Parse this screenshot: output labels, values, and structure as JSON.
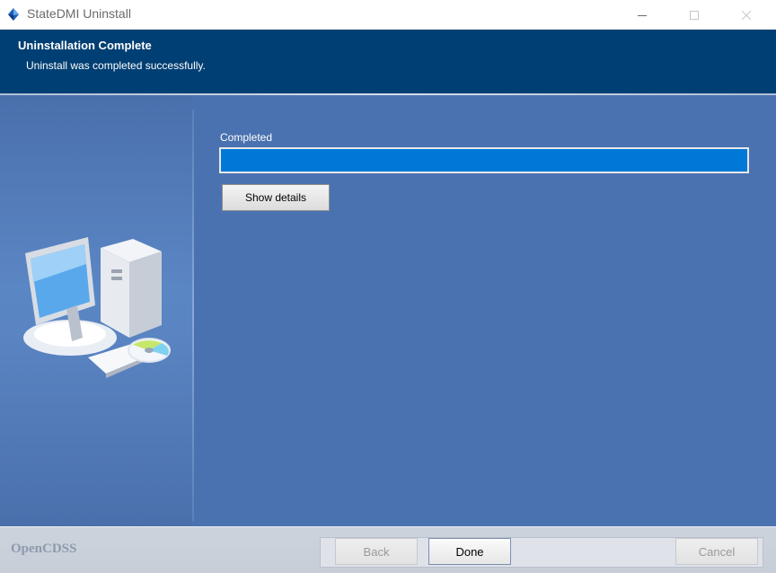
{
  "window": {
    "title": "StateDMI Uninstall",
    "icon": "blue-drop-icon",
    "controls": [
      "minimize-icon",
      "maximize-icon",
      "close-icon"
    ]
  },
  "header": {
    "title": "Uninstallation Complete",
    "subtitle": "Uninstall was completed successfully."
  },
  "main": {
    "status_label": "Completed",
    "progress_percent": 100,
    "show_details_label": "Show details"
  },
  "footer": {
    "brand": "OpenCDSS",
    "back_label": "Back",
    "done_label": "Done",
    "cancel_label": "Cancel"
  },
  "colors": {
    "header_bg": "#003f73",
    "body_bg": "#4a72b0",
    "progress_fill": "#0078d7"
  }
}
